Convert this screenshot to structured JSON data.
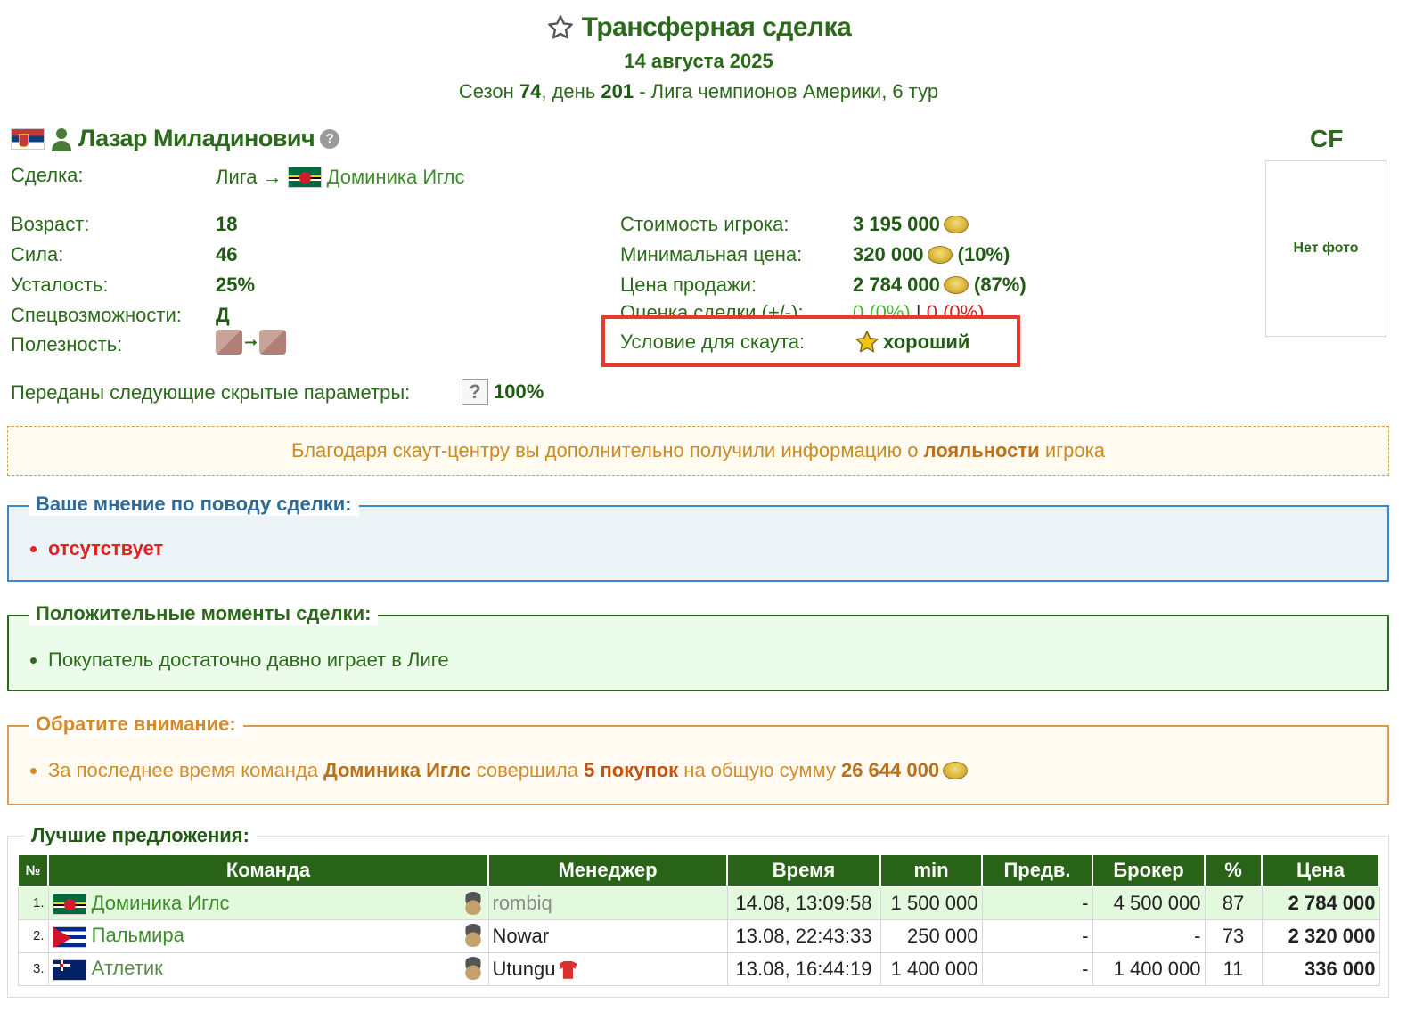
{
  "header": {
    "title": "Трансферная сделка",
    "date": "14 августа 2025",
    "season_prefix": "Сезон ",
    "season_num": "74",
    "day_prefix": ", день ",
    "day_num": "201",
    "league_suffix": " - Лига чемпионов Америки, 6 тур"
  },
  "player": {
    "name": "Лазар Миладинович",
    "position": "CF",
    "photo_text": "Нет фото"
  },
  "deal": {
    "label": "Сделка:",
    "from": "Лига →",
    "to_team": "Доминика Иглс"
  },
  "stats_left": [
    {
      "label": "Возраст:",
      "value": "18"
    },
    {
      "label": "Сила:",
      "value": "46"
    },
    {
      "label": "Усталость:",
      "value": "25%"
    },
    {
      "label": "Спецвозможности:",
      "value": "Д"
    },
    {
      "label": "Полезность:",
      "value": ""
    }
  ],
  "stats_right": {
    "cost_label": "Стоимость игрока:",
    "cost_value": "3 195 000",
    "min_label": "Минимальная цена:",
    "min_value": "320 000",
    "min_pct": "(10%)",
    "sale_label": "Цена продажи:",
    "sale_value": "2 784 000",
    "sale_pct": "(87%)",
    "rating_label": "Оценка сделки (+/-):",
    "rating_pos": "0 (0%)",
    "rating_sep": " | ",
    "rating_neg": "0 (0%)",
    "scout_label": "Условие для скаута:",
    "scout_value": "хороший"
  },
  "hidden": {
    "label": "Переданы следующие скрытые параметры:",
    "value": "100%"
  },
  "notice": {
    "prefix": "Благодаря скаут-центру вы дополнительно получили информацию о ",
    "bold": "лояльности",
    "suffix": " игрока"
  },
  "opinion": {
    "legend": "Ваше мнение по поводу сделки:",
    "item": "отсутствует"
  },
  "positives": {
    "legend": "Положительные моменты сделки:",
    "item": "Покупатель достаточно давно играет в Лиге"
  },
  "attention": {
    "legend": "Обратите внимание:",
    "p1": "За последнее время команда ",
    "team": "Доминика Иглс",
    "p2": " совершила ",
    "count": "5 покупок",
    "p3": " на общую сумму ",
    "sum": "26 644 000"
  },
  "offers": {
    "legend": "Лучшие предложения:",
    "columns": [
      "№",
      "Команда",
      "Менеджер",
      "Время",
      "min",
      "Предв.",
      "Брокер",
      "%",
      "Цена"
    ],
    "rows": [
      {
        "num": "1.",
        "team": "Доминика Иглс",
        "manager": "rombiq",
        "time": "14.08, 13:09:58",
        "min": "1 500 000",
        "pre": "-",
        "broker": "4 500 000",
        "pct": "87",
        "price": "2 784 000"
      },
      {
        "num": "2.",
        "team": "Пальмира",
        "manager": "Nowar",
        "time": "13.08, 22:43:33",
        "min": "250 000",
        "pre": "-",
        "broker": "-",
        "pct": "73",
        "price": "2 320 000"
      },
      {
        "num": "3.",
        "team": "Атлетик",
        "manager": "Utungu",
        "time": "13.08, 16:44:19",
        "min": "1 400 000",
        "pre": "-",
        "broker": "1 400 000",
        "pct": "11",
        "price": "336 000"
      }
    ]
  },
  "colors": {
    "brand_green": "#2b6a1a",
    "header_green": "#296318",
    "highlight_red": "#e53a2c",
    "warning_orange": "#d48b2a"
  }
}
